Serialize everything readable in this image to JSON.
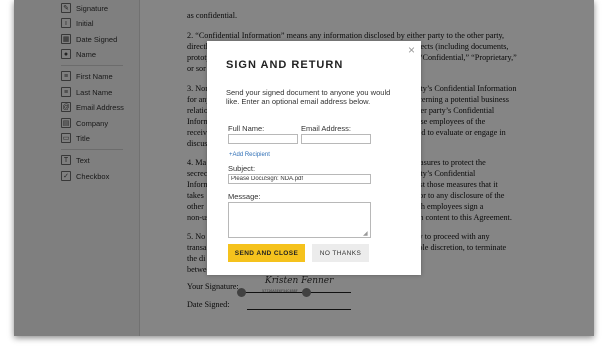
{
  "sidebar": {
    "items": [
      {
        "label": "Signature",
        "icon": "signature-icon",
        "glyph": "✎"
      },
      {
        "label": "Initial",
        "icon": "initial-icon",
        "glyph": "ı"
      },
      {
        "label": "Date Signed",
        "icon": "calendar-icon",
        "glyph": "▦"
      },
      {
        "label": "Name",
        "icon": "user-icon",
        "glyph": "●"
      },
      {
        "label": "First Name",
        "icon": "id-card-icon",
        "glyph": "≡"
      },
      {
        "label": "Last Name",
        "icon": "id-card-icon",
        "glyph": "≡"
      },
      {
        "label": "Email Address",
        "icon": "at-icon",
        "glyph": "@"
      },
      {
        "label": "Company",
        "icon": "building-icon",
        "glyph": "▤"
      },
      {
        "label": "Title",
        "icon": "briefcase-icon",
        "glyph": "▭"
      },
      {
        "label": "Text",
        "icon": "text-icon",
        "glyph": "T"
      },
      {
        "label": "Checkbox",
        "icon": "checkbox-icon",
        "glyph": "✓"
      }
    ]
  },
  "document": {
    "lines": [
      "as confidential.",
      "2. “Confidential Information” means any information disclosed by either party to the other party,",
      "directl",
      "objects (including documents,",
      "prototy",
      "as “Confidential,” “Proprietary,”",
      "or sor",
      "3. Non",
      "party’s Confidential Information",
      "for any",
      "oncerning a potential business",
      "relatio",
      "other party’s Confidential",
      "Inform",
      "those employees of the",
      "receivi",
      "need to evaluate or engage in",
      "discus",
      "4. Ma",
      "measures to protect the",
      "secrec",
      "party’s Confidential",
      "Inform",
      "least those measures that it",
      "takes",
      "prior to any disclosure of the",
      "other",
      "such employees sign a",
      "non-us",
      "ir in content to this Agreement.",
      "5. No",
      "arty to proceed with any",
      "transa",
      "s sole discretion, to terminate",
      "the di",
      "betwe"
    ],
    "signature_label": "Your Signature:",
    "date_label": "Date Signed:",
    "signature_script": "Kristen Fenner",
    "signature_id": "57726A5E6F54C4B8F"
  },
  "modal": {
    "close_glyph": "×",
    "title": "SIGN AND RETURN",
    "description": "Send your signed document to anyone you would like. Enter an optional email address below.",
    "full_name_label": "Full Name:",
    "email_label": "Email Address:",
    "full_name_value": "",
    "email_value": "",
    "add_recipient": "+Add Recipient",
    "subject_label": "Subject:",
    "subject_value": "Please DocuSign: NDA.pdf",
    "message_label": "Message:",
    "message_value": "",
    "primary_button": "SEND AND CLOSE",
    "secondary_button": "NO THANKS",
    "accent_color": "#f5c21d"
  }
}
